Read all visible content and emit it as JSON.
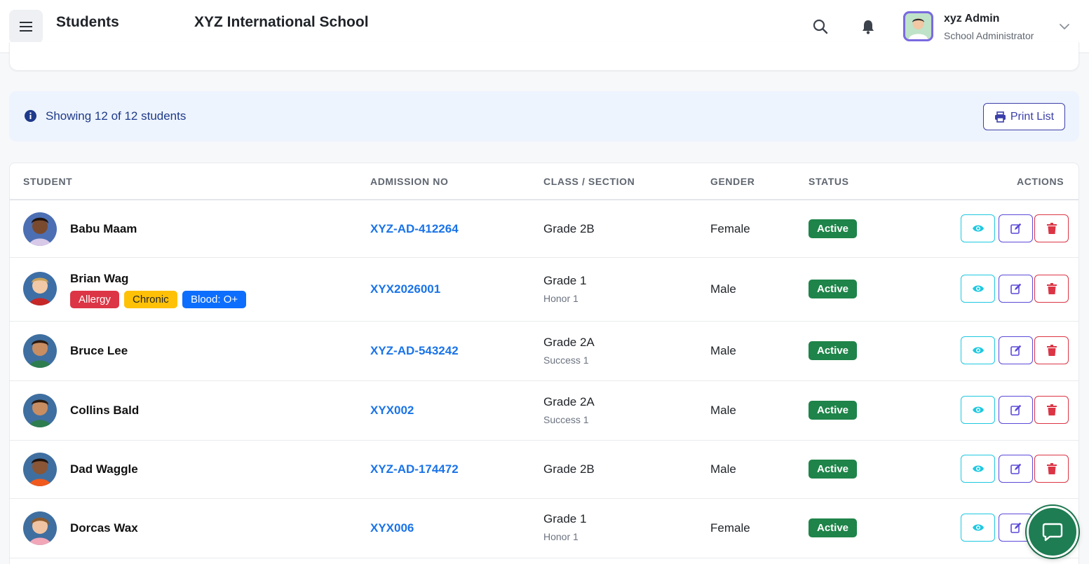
{
  "header": {
    "page_title": "Students",
    "school_name": "XYZ International School",
    "user_name": "xyz Admin",
    "user_role": "School Administrator"
  },
  "info": {
    "message": "Showing 12 of 12 students",
    "print_label": "Print List"
  },
  "table": {
    "columns": [
      "STUDENT",
      "ADMISSION NO",
      "CLASS / SECTION",
      "GENDER",
      "STATUS",
      "ACTIONS"
    ],
    "rows": [
      {
        "name": "Babu Maam",
        "admission_no": "XYZ-AD-412264",
        "class": "Grade 2B",
        "section": "",
        "gender": "Female",
        "status": "Active",
        "tags": []
      },
      {
        "name": "Brian Wag",
        "admission_no": "XYX2026001",
        "class": "Grade 1",
        "section": "Honor 1",
        "gender": "Male",
        "status": "Active",
        "tags": [
          "Allergy",
          "Chronic",
          "Blood: O+"
        ]
      },
      {
        "name": "Bruce Lee",
        "admission_no": "XYZ-AD-543242",
        "class": "Grade 2A",
        "section": "Success 1",
        "gender": "Male",
        "status": "Active",
        "tags": []
      },
      {
        "name": "Collins Bald",
        "admission_no": "XYX002",
        "class": "Grade 2A",
        "section": "Success 1",
        "gender": "Male",
        "status": "Active",
        "tags": []
      },
      {
        "name": "Dad Waggle",
        "admission_no": "XYZ-AD-174472",
        "class": "Grade 2B",
        "section": "",
        "gender": "Male",
        "status": "Active",
        "tags": []
      },
      {
        "name": "Dorcas Wax",
        "admission_no": "XYX006",
        "class": "Grade 1",
        "section": "Honor 1",
        "gender": "Female",
        "status": "Active",
        "tags": []
      }
    ]
  },
  "icons": {
    "menu": "hamburger-icon",
    "search": "search-icon",
    "notifications": "bell-icon",
    "info": "info-icon",
    "print": "printer-icon",
    "view": "eye-icon",
    "edit": "edit-icon",
    "delete": "trash-icon",
    "chat": "chat-icon"
  },
  "colors": {
    "link": "#1a73e8",
    "status_active": "#1e8449",
    "allergy": "#dc3545",
    "chronic": "#ffc107",
    "blood": "#0d6efd",
    "chat_fab": "#1e7d53"
  }
}
